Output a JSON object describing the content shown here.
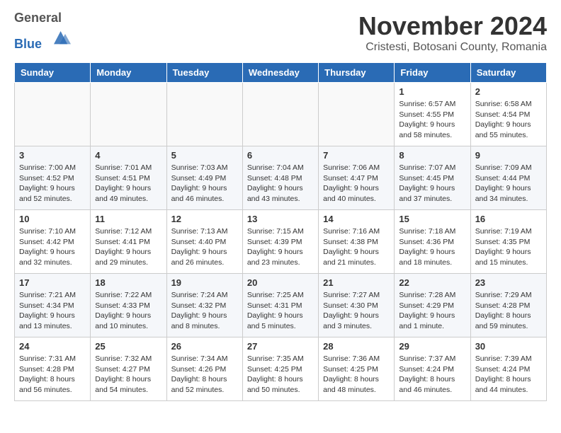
{
  "logo": {
    "general": "General",
    "blue": "Blue"
  },
  "title": "November 2024",
  "subtitle": "Cristesti, Botosani County, Romania",
  "days_of_week": [
    "Sunday",
    "Monday",
    "Tuesday",
    "Wednesday",
    "Thursday",
    "Friday",
    "Saturday"
  ],
  "weeks": [
    [
      {
        "day": "",
        "info": ""
      },
      {
        "day": "",
        "info": ""
      },
      {
        "day": "",
        "info": ""
      },
      {
        "day": "",
        "info": ""
      },
      {
        "day": "",
        "info": ""
      },
      {
        "day": "1",
        "info": "Sunrise: 6:57 AM\nSunset: 4:55 PM\nDaylight: 9 hours and 58 minutes."
      },
      {
        "day": "2",
        "info": "Sunrise: 6:58 AM\nSunset: 4:54 PM\nDaylight: 9 hours and 55 minutes."
      }
    ],
    [
      {
        "day": "3",
        "info": "Sunrise: 7:00 AM\nSunset: 4:52 PM\nDaylight: 9 hours and 52 minutes."
      },
      {
        "day": "4",
        "info": "Sunrise: 7:01 AM\nSunset: 4:51 PM\nDaylight: 9 hours and 49 minutes."
      },
      {
        "day": "5",
        "info": "Sunrise: 7:03 AM\nSunset: 4:49 PM\nDaylight: 9 hours and 46 minutes."
      },
      {
        "day": "6",
        "info": "Sunrise: 7:04 AM\nSunset: 4:48 PM\nDaylight: 9 hours and 43 minutes."
      },
      {
        "day": "7",
        "info": "Sunrise: 7:06 AM\nSunset: 4:47 PM\nDaylight: 9 hours and 40 minutes."
      },
      {
        "day": "8",
        "info": "Sunrise: 7:07 AM\nSunset: 4:45 PM\nDaylight: 9 hours and 37 minutes."
      },
      {
        "day": "9",
        "info": "Sunrise: 7:09 AM\nSunset: 4:44 PM\nDaylight: 9 hours and 34 minutes."
      }
    ],
    [
      {
        "day": "10",
        "info": "Sunrise: 7:10 AM\nSunset: 4:42 PM\nDaylight: 9 hours and 32 minutes."
      },
      {
        "day": "11",
        "info": "Sunrise: 7:12 AM\nSunset: 4:41 PM\nDaylight: 9 hours and 29 minutes."
      },
      {
        "day": "12",
        "info": "Sunrise: 7:13 AM\nSunset: 4:40 PM\nDaylight: 9 hours and 26 minutes."
      },
      {
        "day": "13",
        "info": "Sunrise: 7:15 AM\nSunset: 4:39 PM\nDaylight: 9 hours and 23 minutes."
      },
      {
        "day": "14",
        "info": "Sunrise: 7:16 AM\nSunset: 4:38 PM\nDaylight: 9 hours and 21 minutes."
      },
      {
        "day": "15",
        "info": "Sunrise: 7:18 AM\nSunset: 4:36 PM\nDaylight: 9 hours and 18 minutes."
      },
      {
        "day": "16",
        "info": "Sunrise: 7:19 AM\nSunset: 4:35 PM\nDaylight: 9 hours and 15 minutes."
      }
    ],
    [
      {
        "day": "17",
        "info": "Sunrise: 7:21 AM\nSunset: 4:34 PM\nDaylight: 9 hours and 13 minutes."
      },
      {
        "day": "18",
        "info": "Sunrise: 7:22 AM\nSunset: 4:33 PM\nDaylight: 9 hours and 10 minutes."
      },
      {
        "day": "19",
        "info": "Sunrise: 7:24 AM\nSunset: 4:32 PM\nDaylight: 9 hours and 8 minutes."
      },
      {
        "day": "20",
        "info": "Sunrise: 7:25 AM\nSunset: 4:31 PM\nDaylight: 9 hours and 5 minutes."
      },
      {
        "day": "21",
        "info": "Sunrise: 7:27 AM\nSunset: 4:30 PM\nDaylight: 9 hours and 3 minutes."
      },
      {
        "day": "22",
        "info": "Sunrise: 7:28 AM\nSunset: 4:29 PM\nDaylight: 9 hours and 1 minute."
      },
      {
        "day": "23",
        "info": "Sunrise: 7:29 AM\nSunset: 4:28 PM\nDaylight: 8 hours and 59 minutes."
      }
    ],
    [
      {
        "day": "24",
        "info": "Sunrise: 7:31 AM\nSunset: 4:28 PM\nDaylight: 8 hours and 56 minutes."
      },
      {
        "day": "25",
        "info": "Sunrise: 7:32 AM\nSunset: 4:27 PM\nDaylight: 8 hours and 54 minutes."
      },
      {
        "day": "26",
        "info": "Sunrise: 7:34 AM\nSunset: 4:26 PM\nDaylight: 8 hours and 52 minutes."
      },
      {
        "day": "27",
        "info": "Sunrise: 7:35 AM\nSunset: 4:25 PM\nDaylight: 8 hours and 50 minutes."
      },
      {
        "day": "28",
        "info": "Sunrise: 7:36 AM\nSunset: 4:25 PM\nDaylight: 8 hours and 48 minutes."
      },
      {
        "day": "29",
        "info": "Sunrise: 7:37 AM\nSunset: 4:24 PM\nDaylight: 8 hours and 46 minutes."
      },
      {
        "day": "30",
        "info": "Sunrise: 7:39 AM\nSunset: 4:24 PM\nDaylight: 8 hours and 44 minutes."
      }
    ]
  ]
}
